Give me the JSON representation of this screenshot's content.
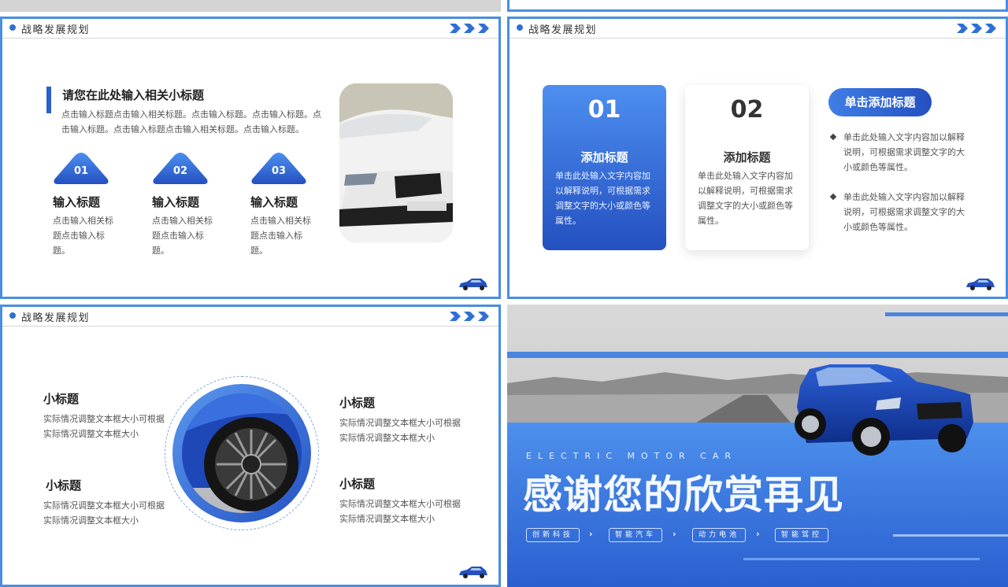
{
  "theme": {
    "accent": "#2f6fd6",
    "accent_dark": "#2450c0",
    "border": "#4a8ee0"
  },
  "slide_a": {
    "header_title": "战略发展规划",
    "subheading": "请您在此处输入相关小标题",
    "paragraph": "点击输入标题点击输入相关标题。点击输入标题。点击输入标题。点击输入标题。点击输入标题点击输入相关标题。点击输入标题。",
    "items": [
      {
        "num": "01",
        "title": "输入标题",
        "text": "点击输入相关标题点击输入标题。"
      },
      {
        "num": "02",
        "title": "输入标题",
        "text": "点击输入相关标题点击输入标题。"
      },
      {
        "num": "03",
        "title": "输入标题",
        "text": "点击输入相关标题点击输入标题。"
      }
    ],
    "photo": "white-sports-car-photo"
  },
  "slide_b": {
    "header_title": "战略发展规划",
    "cards": [
      {
        "num": "01",
        "title": "添加标题",
        "text": "单击此处输入文字内容加以解释说明，可根据需求调整文字的大小或颜色等属性。"
      },
      {
        "num": "02",
        "title": "添加标题",
        "text": "单击此处输入文字内容加以解释说明，可根据需求调整文字的大小或颜色等属性。"
      }
    ],
    "pill_title": "单击添加标题",
    "bullets": [
      "单击此处输入文字内容加以解释说明，可根据需求调整文字的大小或颜色等属性。",
      "单击此处输入文字内容加以解释说明，可根据需求调整文字的大小或颜色等属性。"
    ]
  },
  "slide_c": {
    "header_title": "战略发展规划",
    "blocks": [
      {
        "title": "小标题",
        "text": "实际情况调整文本框大小可根据实际情况调整文本框大小"
      },
      {
        "title": "小标题",
        "text": "实际情况调整文本框大小可根据实际情况调整文本框大小"
      },
      {
        "title": "小标题",
        "text": "实际情况调整文本框大小可根据实际情况调整文本框大小"
      },
      {
        "title": "小标题",
        "text": "实际情况调整文本框大小可根据实际情况调整文本框大小"
      }
    ],
    "photo": "blue-car-wheel-photo"
  },
  "slide_d": {
    "eng_text": "ELECTRIC MOTOR CAR",
    "main_text": "感谢您的欣赏再见",
    "tags": [
      "创新科技",
      "智能汽车",
      "动力电池",
      "智能驾控"
    ],
    "photo": "blue-suv-road-photo"
  }
}
